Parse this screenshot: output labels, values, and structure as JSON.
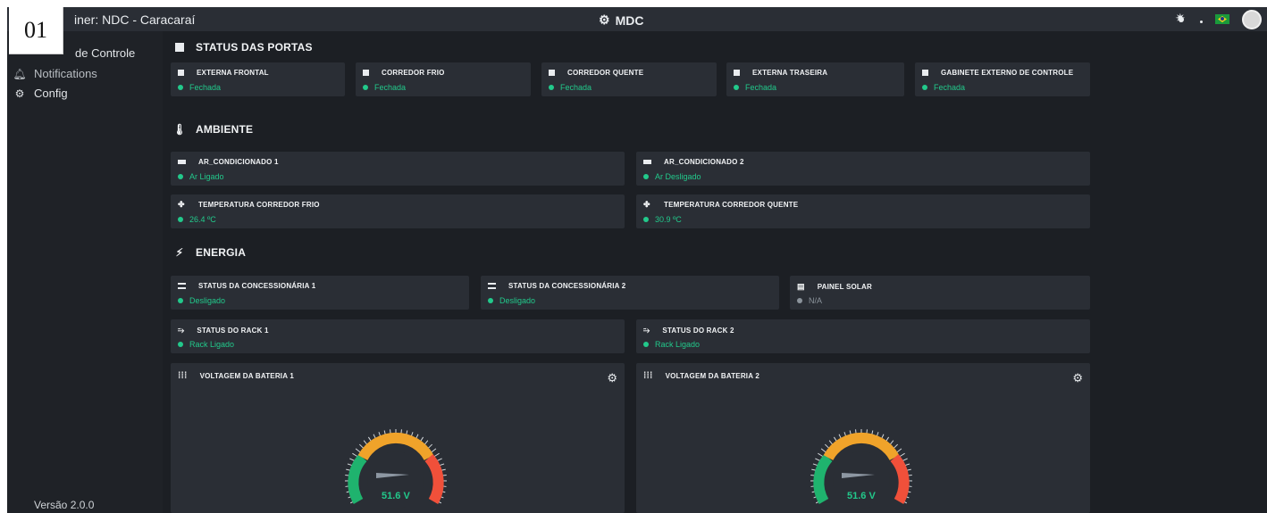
{
  "header": {
    "title_partial": "iner: NDC - Caracaraí",
    "center_title": "MDC",
    "annotation_label": "01"
  },
  "sidebar": {
    "items": [
      {
        "label": "de Controle",
        "icon": "dashboard-icon"
      },
      {
        "label": "Notifications",
        "icon": "bell-icon"
      },
      {
        "label": "Config",
        "icon": "gear-icon"
      }
    ],
    "version": "Versão 2.0.0"
  },
  "sections": {
    "portas": {
      "title": "STATUS DAS PORTAS",
      "cards": [
        {
          "label": "EXTERNA FRONTAL",
          "status": "Fechada"
        },
        {
          "label": "CORREDOR FRIO",
          "status": "Fechada"
        },
        {
          "label": "CORREDOR QUENTE",
          "status": "Fechada"
        },
        {
          "label": "EXTERNA TRASEIRA",
          "status": "Fechada"
        },
        {
          "label": "GABINETE EXTERNO DE CONTROLE",
          "status": "Fechada"
        }
      ]
    },
    "ambiente": {
      "title": "AMBIENTE",
      "cards": [
        {
          "label": "AR_CONDICIONADO 1",
          "status": "Ar Ligado"
        },
        {
          "label": "AR_CONDICIONADO 2",
          "status": "Ar Desligado"
        },
        {
          "label": "TEMPERATURA CORREDOR FRIO",
          "status": "26.4 ºC"
        },
        {
          "label": "TEMPERATURA CORREDOR QUENTE",
          "status": "30.9 ºC"
        }
      ]
    },
    "energia": {
      "title": "ENERGIA",
      "cards": [
        {
          "label": "STATUS DA CONCESSIONÁRIA 1",
          "status": "Desligado"
        },
        {
          "label": "STATUS DA CONCESSIONÁRIA 2",
          "status": "Desligado"
        },
        {
          "label": "PAINEL SOLAR",
          "status": "N/A"
        },
        {
          "label": "STATUS DO RACK 1",
          "status": "Rack Ligado"
        },
        {
          "label": "STATUS DO RACK 2",
          "status": "Rack Ligado"
        }
      ]
    },
    "baterias": [
      {
        "label": "VOLTAGEM DA BATERIA 1",
        "value": "51.6 V",
        "level": 0.42
      },
      {
        "label": "VOLTAGEM DA BATERIA 2",
        "value": "51.6 V",
        "level": 0.42
      }
    ]
  },
  "colors": {
    "accent": "#22c98b",
    "card_bg": "#2a2e35",
    "page_bg": "#1c1f24",
    "gauge_low": "#1fb36e",
    "gauge_mid": "#f0a32a",
    "gauge_high": "#f0503a"
  }
}
